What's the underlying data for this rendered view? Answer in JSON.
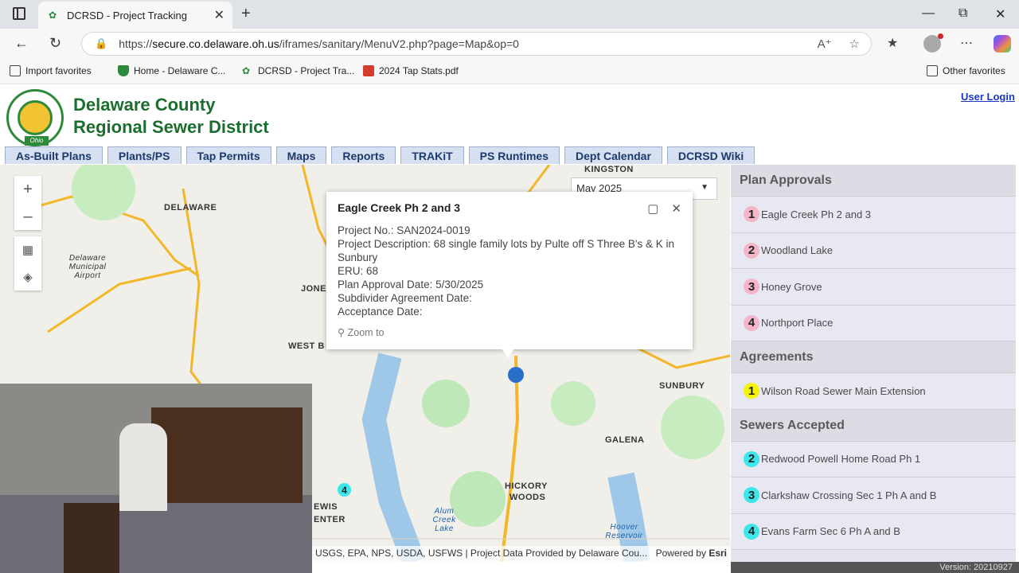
{
  "browser": {
    "tab_title": "DCRSD - Project Tracking",
    "url_prefix": "https://",
    "url_host": "secure.co.delaware.oh.us",
    "url_path": "/iframes/sanitary/MenuV2.php?page=Map&op=0"
  },
  "bookmarks": [
    {
      "label": "Import favorites",
      "icon": "import-icon"
    },
    {
      "label": "Home - Delaware C...",
      "icon": "shield-icon"
    },
    {
      "label": "DCRSD - Project Tra...",
      "icon": "site-icon"
    },
    {
      "label": "2024 Tap Stats.pdf",
      "icon": "pdf-icon"
    }
  ],
  "other_favorites": "Other favorites",
  "header": {
    "org_line1": "Delaware County",
    "org_line2": "Regional Sewer District",
    "login": "User Login",
    "logo_text": "Ohio"
  },
  "menu": [
    "As-Built Plans",
    "Plants/PS",
    "Tap Permits",
    "Maps",
    "Reports",
    "TRAKiT",
    "PS Runtimes",
    "Dept Calendar",
    "DCRSD Wiki"
  ],
  "map": {
    "month": "May 2025",
    "labels": {
      "kingston": "KINGSTON",
      "delaware": "DELAWARE",
      "west_b": "WEST B",
      "jone": "JONE",
      "sunbury": "SUNBURY",
      "galena": "GALENA",
      "hickory": "HICKORY",
      "woods": "WOODS",
      "lewis": "EWIS",
      "center": "ENTER",
      "airport": "Delaware Municipal Airport",
      "alum_lake": "Alum Creek Lake",
      "hoover": "Hoover Reservoir"
    },
    "attribution": "USGS, EPA, NPS, USDA, USFWS | Project Data Provided by Delaware Cou...",
    "powered": "Powered by",
    "esri": "Esri",
    "marker": "4"
  },
  "popup": {
    "title": "Eagle Creek Ph 2 and 3",
    "project_no": "Project No.: SAN2024-0019",
    "description": "Project Description: 68 single family lots by Pulte off S Three B's & K in Sunbury",
    "eru": "ERU: 68",
    "approval": "Plan Approval Date: 5/30/2025",
    "subdivider": "Subdivider Agreement Date:",
    "acceptance": "Acceptance Date:",
    "zoom": "Zoom to"
  },
  "sidebar": {
    "sections": [
      {
        "title": "Plan Approvals",
        "color": "pink",
        "items": [
          {
            "num": "1",
            "label": "Eagle Creek Ph 2 and 3"
          },
          {
            "num": "2",
            "label": "Woodland Lake"
          },
          {
            "num": "3",
            "label": "Honey Grove"
          },
          {
            "num": "4",
            "label": "Northport Place"
          }
        ]
      },
      {
        "title": "Agreements",
        "color": "yellow",
        "items": [
          {
            "num": "1",
            "label": "Wilson Road Sewer Main Extension"
          }
        ]
      },
      {
        "title": "Sewers Accepted",
        "color": "cyan",
        "items": [
          {
            "num": "2",
            "label": "Redwood Powell Home Road Ph 1"
          },
          {
            "num": "3",
            "label": "Clarkshaw Crossing Sec 1 Ph A and B"
          },
          {
            "num": "4",
            "label": "Evans Farm Sec 6 Ph A and B"
          }
        ]
      }
    ]
  },
  "version": "Version: 20210927"
}
